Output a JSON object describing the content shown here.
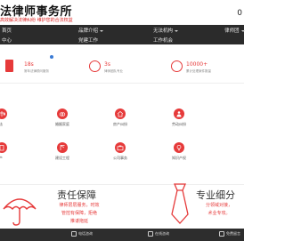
{
  "header": {
    "title": "法律师事务所",
    "subtitle": "高效解决法律纠纷 维护您的合法权益",
    "phone_partial": "0"
  },
  "nav": {
    "row1": [
      "首页",
      "品牌介绍",
      "无法机构",
      "律师团"
    ],
    "row2": [
      "中心",
      "党建工作",
      "工作机会"
    ]
  },
  "stats": [
    {
      "num": "18s",
      "label": "常年法律顾问服务"
    },
    {
      "num": "3s",
      "label": "律师团队专业"
    },
    {
      "num": "10000+",
      "label": "累计处理案件数量"
    }
  ],
  "services": [
    {
      "label": "法",
      "icon": "scale-icon"
    },
    {
      "label": "婚姻家庭",
      "icon": "rings-icon"
    },
    {
      "label": "房产纠纷",
      "icon": "house-icon"
    },
    {
      "label": "劳动纠纷",
      "icon": "worker-icon"
    },
    {
      "label": "产",
      "icon": "building-icon"
    },
    {
      "label": "建设工程",
      "icon": "crane-icon"
    },
    {
      "label": "公司事务",
      "icon": "briefcase-icon"
    },
    {
      "label": "知识产权",
      "icon": "bulb-icon"
    }
  ],
  "features": [
    {
      "title": "责任保障",
      "lines": [
        "律师层层服务，时效",
        "管控有保障，拒绝",
        "推诿拖延"
      ]
    },
    {
      "title": "专业细分",
      "lines": [
        "分领域对接，",
        "术业专攻。"
      ]
    }
  ],
  "tabbar": [
    {
      "label": "电话咨询",
      "icon": "phone-icon"
    },
    {
      "label": "在线咨询",
      "icon": "chat-icon"
    },
    {
      "label": "免费留言",
      "icon": "message-icon"
    }
  ],
  "colors": {
    "accent": "#e63a3a",
    "nav_bg": "#2b2b2b",
    "tabbar_bg": "#2d2d2d"
  }
}
